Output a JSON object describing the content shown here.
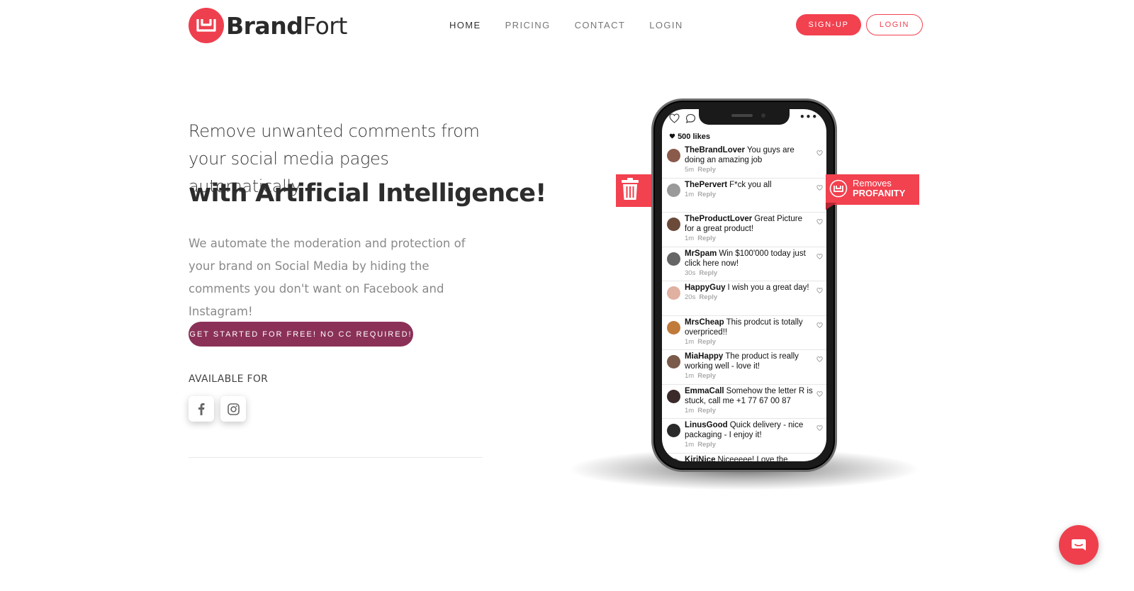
{
  "header": {
    "logo": {
      "bold": "Brand",
      "light": "Fort"
    },
    "nav": [
      {
        "label": "HOME",
        "active": true
      },
      {
        "label": "PRICING",
        "active": false
      },
      {
        "label": "CONTACT",
        "active": false
      },
      {
        "label": "LOGIN",
        "active": false
      }
    ],
    "signup_label": "SIGN-UP",
    "login_label": "LOGIN"
  },
  "hero": {
    "headline": "Remove unwanted comments from your social media pages automatically",
    "headline_emphasis": "with Artificial Intelligence!",
    "description": "We automate the moderation and protection of your brand on Social Media by hiding the comments you don't want on Facebook and Instagram!",
    "cta_label": "GET STARTED FOR FREE! NO CC REQUIRED!",
    "available_for": "AVAILABLE FOR",
    "platforms": [
      "facebook-icon",
      "instagram-icon"
    ]
  },
  "phone": {
    "likes": "500 likes",
    "comments": [
      {
        "user": "TheBrandLover",
        "text": "You guys are doing an amazing job",
        "time": "5m",
        "reply": "Reply",
        "avatar_color": "#8a5a4a"
      },
      {
        "user": "ThePervert",
        "text": "F*ck you all",
        "time": "1m",
        "reply": "Reply",
        "avatar_color": "#9a9a9a"
      },
      {
        "user": "TheProductLover",
        "text": "Great Picture for a great product!",
        "time": "1m",
        "reply": "Reply",
        "avatar_color": "#6b4a3a"
      },
      {
        "user": "MrSpam",
        "text": "Win $100'000 today just click here now!",
        "time": "30s",
        "reply": "Reply",
        "avatar_color": "#666666"
      },
      {
        "user": "HappyGuy",
        "text": "I wish you a great day!",
        "time": "20s",
        "reply": "Reply",
        "avatar_color": "#e0b0a0"
      },
      {
        "user": "MrsCheap",
        "text": "This prodcut is totally overpriced!!",
        "time": "1m",
        "reply": "Reply",
        "avatar_color": "#c07a3a"
      },
      {
        "user": "MiaHappy",
        "text": "The product is really working well - love it!",
        "time": "1m",
        "reply": "Reply",
        "avatar_color": "#7a5a4a"
      },
      {
        "user": "EmmaCall",
        "text": "Somehow the letter R is stuck, call me +1 77 67 00 87",
        "time": "1m",
        "reply": "Reply",
        "avatar_color": "#3a2a2a"
      },
      {
        "user": "LinusGood",
        "text": "Quick delivery - nice packaging - I enjoy it!",
        "time": "1m",
        "reply": "Reply",
        "avatar_color": "#2a2a2a"
      },
      {
        "user": "KiriNice",
        "text": "Niceeeee! Love the design of it!",
        "time": "",
        "reply": "",
        "avatar_color": "#3a4a5a"
      }
    ]
  },
  "ribbon": {
    "line1": "Removes",
    "line2": "PROFANITY"
  },
  "colors": {
    "brand_red": "#f2414f",
    "cta_purple": "#8b3158"
  }
}
